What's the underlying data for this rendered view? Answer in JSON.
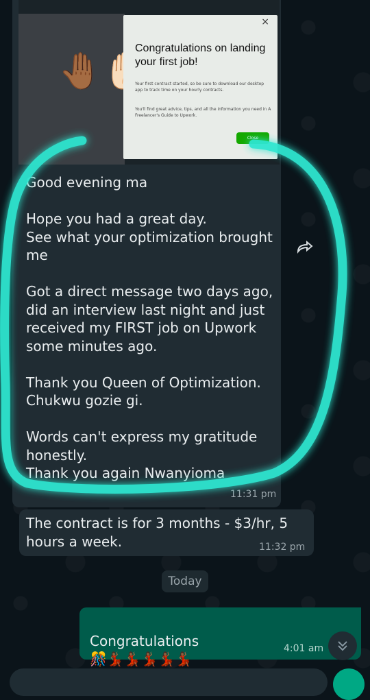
{
  "screenshot": {
    "dialog": {
      "title": "Congratulations on landing your first job!",
      "para1": "Your first contract started, so be sure to download our desktop app to track time on your hourly contracts.",
      "para2": "You'll find great advice, tips, and all the information you need in A Freelancer's Guide to Upwork.",
      "close_label": "Close",
      "close_x": "×"
    },
    "hands_emoji": "🤚🏾✋🏻"
  },
  "messages": [
    {
      "text": "Good evening ma\n\nHope you had a great day.\nSee what your optimization brought me\n\nGot a direct message two days ago, did an interview last night and just received my FIRST job on Upwork some minutes ago.\n\nThank you Queen of Optimization.\nChukwu gozie gi.\n\nWords can't express my gratitude honestly.\nThank you again Nwanyioma",
      "time": "11:31 pm"
    },
    {
      "text": "The contract is for 3 months - $3/hr, 5 hours a week.",
      "time": "11:32 pm"
    }
  ],
  "date_divider": "Today",
  "outgoing": {
    "text": "Congratulations",
    "emojis": "🎊💃🏾💃🏾💃🏾💃🏾💃🏾",
    "time": "4:01 am"
  },
  "colors": {
    "background": "#0b141a",
    "incoming_bubble": "#202c33",
    "outgoing_bubble": "#005c4b",
    "highlight_circle": "#2ee6d0"
  },
  "icons": {
    "forward": "forward-icon",
    "scroll_down": "double-chevron-down-icon"
  }
}
